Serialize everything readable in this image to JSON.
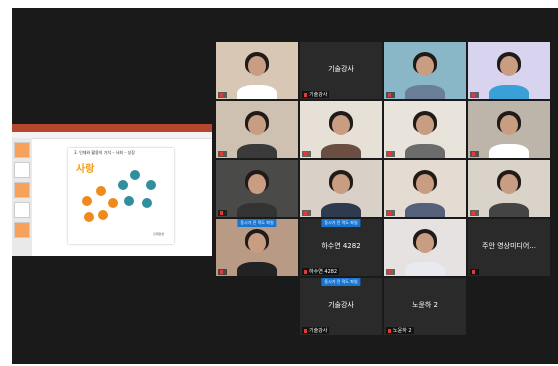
{
  "presentation": {
    "slide_title": "3. 인재와 활용의 가치 – 사회 – 성장",
    "slide_heading": "사랑",
    "slide_note": "인재양성"
  },
  "tiles": [
    {
      "name": "",
      "bg": "#d9c7b5",
      "body": "#ffffff",
      "type": "person"
    },
    {
      "name": "기술강사",
      "type": "text",
      "center": "기술강사"
    },
    {
      "name": "",
      "bg": "#8ab7c7",
      "body": "#6a7f95",
      "type": "person"
    },
    {
      "name": "",
      "bg": "#d8d3ef",
      "body": "#3aa0d8",
      "type": "person",
      "active": true
    },
    {
      "name": "",
      "bg": "#cfc1b2",
      "body": "#3a3a3a",
      "type": "person"
    },
    {
      "name": "",
      "bg": "#e6e0d7",
      "body": "#6a4e42",
      "type": "person"
    },
    {
      "name": "",
      "bg": "#e8e4dc",
      "body": "#6c6c6c",
      "type": "person"
    },
    {
      "name": "",
      "bg": "#bdb5aa",
      "body": "#ffffff",
      "type": "person"
    },
    {
      "name": "",
      "bg": "#4a4a48",
      "body": "#333333",
      "type": "person"
    },
    {
      "name": "",
      "bg": "#d9d1c8",
      "body": "#2e3a4e",
      "type": "person"
    },
    {
      "name": "",
      "bg": "#e4dbd2",
      "body": "#55607a",
      "type": "person"
    },
    {
      "name": "",
      "bg": "#dad3ca",
      "body": "#444444",
      "type": "person"
    },
    {
      "name": "",
      "bg": "#b99a85",
      "body": "#222222",
      "type": "person",
      "badge": "동시가 전 적도 파일"
    },
    {
      "name": "하수연 4282",
      "type": "text",
      "center": "하수연 4282",
      "badge": "동시가 전 적도 파일"
    },
    {
      "name": "",
      "bg": "#e5e2e1",
      "body": "#e8eaf0",
      "type": "person"
    },
    {
      "name": "",
      "type": "text",
      "center": "주안 영상미디어..."
    },
    {
      "name": "기술강사",
      "type": "text",
      "center": "기술강사",
      "badge": "동시가 전 적도 파일"
    },
    {
      "name": "노윤하 2",
      "type": "text",
      "center": "노윤하 2"
    }
  ],
  "icons": {
    "muted": "muted-mic-icon"
  }
}
